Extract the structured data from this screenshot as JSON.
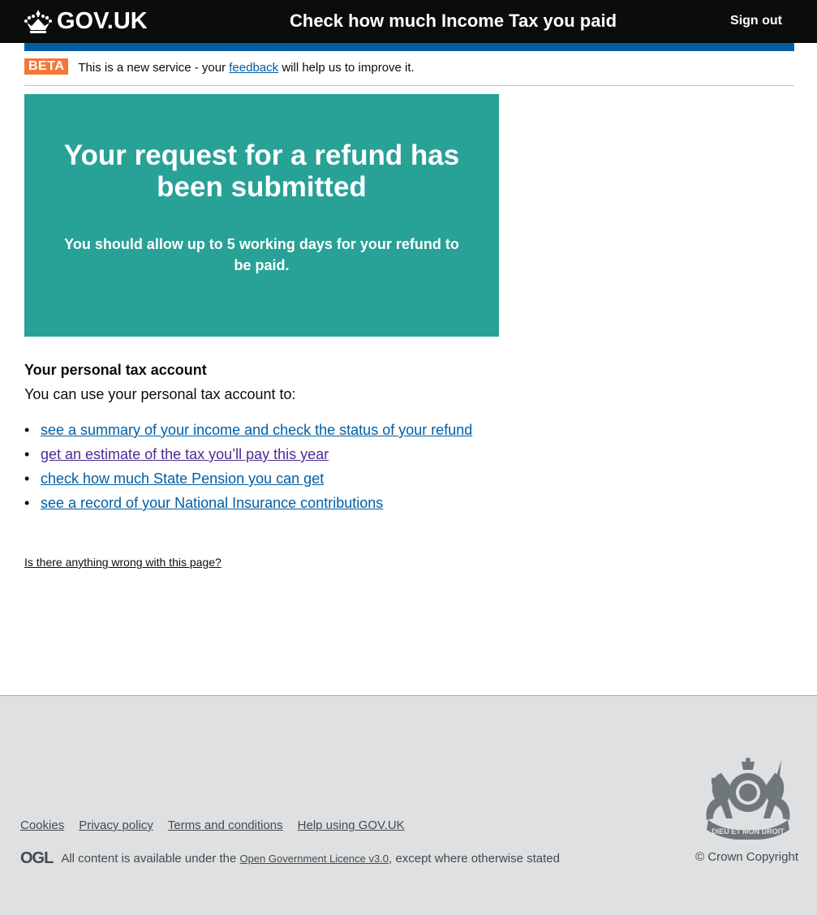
{
  "header": {
    "logo_text": "GOV.UK",
    "service_name": "Check how much Income Tax you paid",
    "sign_out": "Sign out"
  },
  "phase_banner": {
    "tag": "BETA",
    "text_before": "This is a new service - your ",
    "link": "feedback",
    "text_after": " will help us to improve it."
  },
  "confirmation": {
    "title": "Your request for a refund has been submitted",
    "body": "You should allow up to 5 working days for your refund to be paid."
  },
  "account": {
    "heading": "Your personal tax account",
    "intro": "You can use your personal tax account to:",
    "links": [
      {
        "label": "see a summary of your income and check the status of your refund"
      },
      {
        "label": "get an estimate of the tax you’ll pay this year"
      },
      {
        "label": "check how much State Pension you can get"
      },
      {
        "label": "see a record of your National Insurance contributions"
      }
    ]
  },
  "report_link": "Is there anything wrong with this page?",
  "footer": {
    "links": [
      "Cookies",
      "Privacy policy",
      "Terms and conditions",
      "Help using GOV.UK"
    ],
    "ogl": "OGL",
    "licence_before": "All content is available under the ",
    "licence_link": "Open Government Licence v3.0",
    "licence_after": ", except where otherwise stated",
    "copyright": "© Crown Copyright",
    "crest_motto": "DIEU ET MON DROIT"
  },
  "colors": {
    "header": "#0b0c0c",
    "accent": "#005ea5",
    "beta": "#f47738",
    "panel": "#28a197",
    "footer": "#dee0e2",
    "visited": "#4c2c92"
  }
}
